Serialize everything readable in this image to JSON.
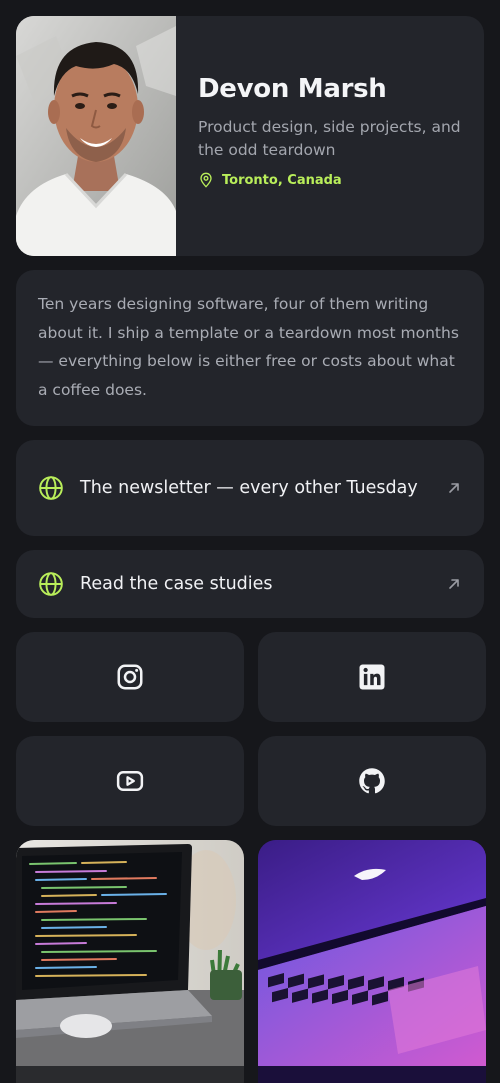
{
  "profile": {
    "name": "Devon Marsh",
    "tagline": "Product design, side projects, and the odd teardown",
    "location": "Toronto, Canada",
    "accent": "#b9ee5a"
  },
  "bio": {
    "text": "Ten years designing software, four of them writing about it. I ship a template or a teardown most months — everything below is either free or costs about what a coffee does."
  },
  "links": [
    {
      "label": "The newsletter — every other Tuesday",
      "icon": "globe-icon",
      "action_icon": "arrow-up-right-icon"
    },
    {
      "label": "Read the case studies",
      "icon": "globe-icon",
      "action_icon": "arrow-up-right-icon"
    }
  ],
  "socials": [
    {
      "icon": "instagram-icon"
    },
    {
      "icon": "linkedin-icon"
    },
    {
      "icon": "youtube-icon"
    },
    {
      "icon": "github-icon"
    }
  ],
  "gallery": [
    {
      "subject": "laptop-with-code"
    },
    {
      "subject": "laptop-purple-light"
    }
  ]
}
